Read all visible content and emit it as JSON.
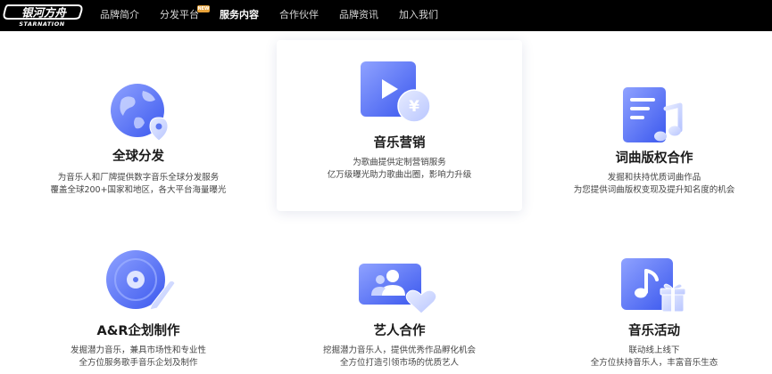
{
  "brand": {
    "logo_cn": "银河方舟",
    "logo_en": "STARNATION"
  },
  "nav": {
    "items": [
      {
        "label": "品牌简介"
      },
      {
        "label": "分发平台",
        "badge": "NEW"
      },
      {
        "label": "服务内容",
        "active": true
      },
      {
        "label": "合作伙伴"
      },
      {
        "label": "品牌资讯"
      },
      {
        "label": "加入我们"
      }
    ]
  },
  "services": [
    {
      "icon": "globe-icon",
      "title": "全球分发",
      "desc": [
        "为音乐人和厂牌提供数字音乐全球分发服务",
        "覆盖全球200+国家和地区，各大平台海量曝光"
      ]
    },
    {
      "icon": "video-marketing-icon",
      "title": "音乐营销",
      "desc": [
        "为歌曲提供定制营销服务",
        "亿万级曝光助力歌曲出圈，影响力升级"
      ]
    },
    {
      "icon": "lyrics-copyright-icon",
      "title": "词曲版权合作",
      "desc": [
        "发掘和扶持优质词曲作品",
        "为您提供词曲版权变现及提升知名度的机会"
      ]
    },
    {
      "icon": "vinyl-record-icon",
      "title": "A&R企划制作",
      "desc": [
        "发掘潜力音乐，兼具市场性和专业性",
        "全方位服务歌手音乐企划及制作"
      ]
    },
    {
      "icon": "artist-collab-icon",
      "title": "艺人合作",
      "desc": [
        "挖掘潜力音乐人，提供优秀作品孵化机会",
        "全方位打造引领市场的优质艺人"
      ]
    },
    {
      "icon": "music-event-icon",
      "title": "音乐活动",
      "desc": [
        "联动线上线下",
        "全方位扶持音乐人，丰富音乐生态"
      ]
    }
  ],
  "colors": {
    "nav_bg": "#000000",
    "icon_blue_dark": "#3f5ef0",
    "icon_blue_light": "#8fa2ff",
    "badge": "#e8a33a"
  }
}
